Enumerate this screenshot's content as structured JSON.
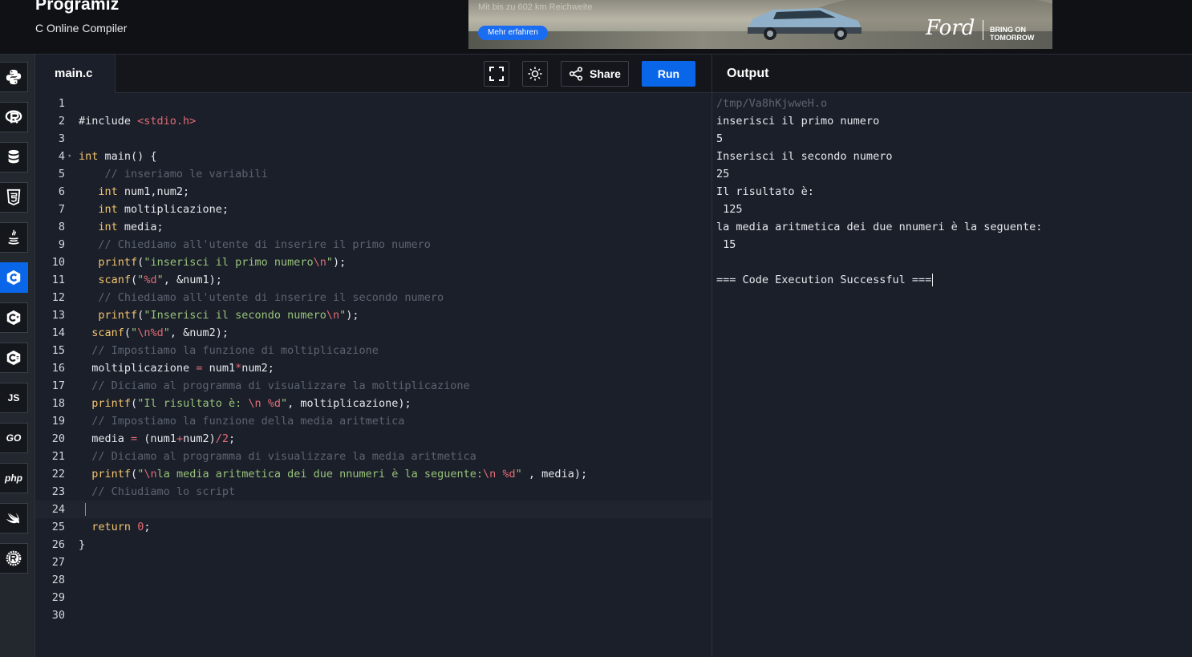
{
  "header": {
    "brand": "Programiz",
    "subtitle": "C Online Compiler"
  },
  "ad": {
    "tagline": "Mit bis zu 602 km Reichweite",
    "button": "Mehr erfahren",
    "logo": "Ford",
    "slogan_line1": "BRING ON",
    "slogan_line2": "TOMORROW"
  },
  "sidebar": {
    "languages": [
      {
        "name": "Python",
        "icon": "python-icon"
      },
      {
        "name": "R",
        "icon": "r-icon"
      },
      {
        "name": "SQL",
        "icon": "database-icon"
      },
      {
        "name": "HTML",
        "icon": "html5-icon"
      },
      {
        "name": "Java",
        "icon": "java-icon"
      },
      {
        "name": "C",
        "icon": "c-icon",
        "active": true
      },
      {
        "name": "C++",
        "icon": "cpp-icon"
      },
      {
        "name": "C#",
        "icon": "csharp-icon"
      },
      {
        "name": "JavaScript",
        "icon": "js-icon",
        "label": "JS"
      },
      {
        "name": "Go",
        "icon": "go-icon",
        "label": "GO"
      },
      {
        "name": "PHP",
        "icon": "php-icon",
        "label": "php"
      },
      {
        "name": "Swift",
        "icon": "swift-icon"
      },
      {
        "name": "Rust",
        "icon": "rust-icon"
      }
    ]
  },
  "editor": {
    "tab": "main.c",
    "share_label": "Share",
    "run_label": "Run",
    "current_line": 24,
    "lines": [
      "",
      "#include <stdio.h>",
      "",
      "int main() {",
      "    // inseriamo le variabili",
      "   int num1,num2;",
      "   int moltiplicazione;",
      "   int media;",
      "   // Chiediamo all'utente di inserire il primo numero",
      "   printf(\"inserisci il primo numero\\n\");",
      "   scanf(\"%d\", &num1);",
      "   // Chiediamo all'utente di inserire il secondo numero",
      "   printf(\"Inserisci il secondo numero\\n\");",
      "  scanf(\"\\n%d\", &num2);",
      "  // Impostiamo la funzione di moltiplicazione",
      "  moltiplicazione = num1*num2;",
      "  // Diciamo al programma di visualizzare la moltiplicazione",
      "  printf(\"Il risultato è: \\n %d\", moltiplicazione);",
      "  // Impostiamo la funzione della media aritmetica",
      "  media = (num1+num2)/2;",
      "  // Diciamo al programma di visualizzare la media aritmetica",
      "  printf(\"\\nla media aritmetica dei due nnumeri è la seguente:\\n %d\" , media);",
      "  // Chiudiamo lo script",
      "",
      "  return 0;",
      "}",
      "",
      "",
      "",
      ""
    ]
  },
  "output": {
    "title": "Output",
    "lines": [
      "/tmp/Va8hKjwweH.o",
      "inserisci il primo numero",
      "5",
      "Inserisci il secondo numero",
      "25",
      "Il risultato è:",
      " 125",
      "la media aritmetica dei due nnumeri è la seguente:",
      " 15",
      "",
      "=== Code Execution Successful ==="
    ]
  },
  "colors": {
    "accent": "#0a66e8",
    "keyword": "#f2c46f",
    "string": "#98c379",
    "escape": "#e06c75",
    "comment": "#5c6370",
    "function": "#f2c46f"
  }
}
